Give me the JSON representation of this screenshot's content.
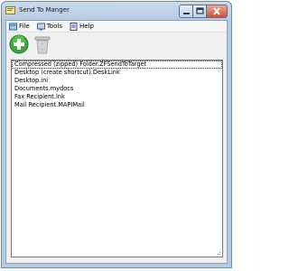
{
  "window": {
    "title": "Send To Manger"
  },
  "menu": [
    {
      "label": "File",
      "icon": "file-icon"
    },
    {
      "label": "Tools",
      "icon": "tools-icon"
    },
    {
      "label": "Help",
      "icon": "help-icon"
    }
  ],
  "toolbar": [
    {
      "icon": "add-icon",
      "enabled": true
    },
    {
      "icon": "recycle-bin-icon",
      "enabled": false
    }
  ],
  "list": {
    "items": [
      "Compressed (zipped) Folder.ZFSendToTarget",
      "Desktop (create shortcut).DeskLink",
      "Desktop.ini",
      "Documents.mydocs",
      "Fax Recipient.lnk",
      "Mail Recipient.MAPIMail"
    ],
    "selected_index": 0
  },
  "colors": {
    "accent_green": "#3aa83a",
    "titlebar": "#c9daec"
  }
}
